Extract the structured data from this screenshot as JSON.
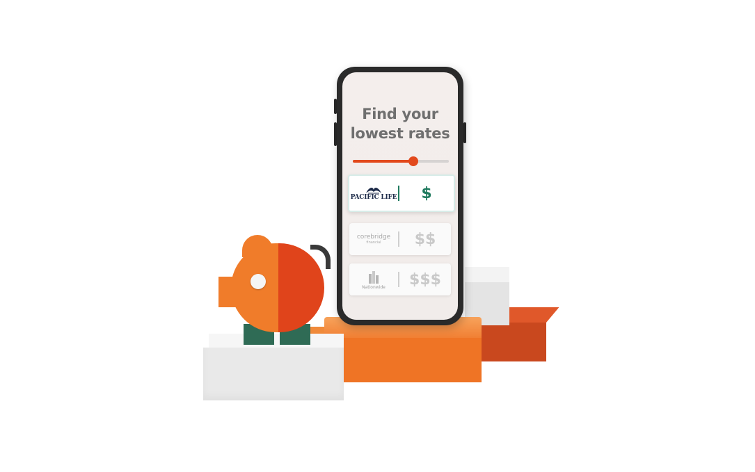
{
  "phone": {
    "headline_line1": "Find your",
    "headline_line2": "lowest rates",
    "slider_value_percent": 63,
    "cards": [
      {
        "logo_text": "PACIFIC LIFE",
        "logo_icon": "whale-tail-logo-icon",
        "price": "$",
        "highlighted": true
      },
      {
        "logo_text": "corebridge",
        "logo_subtext": "financial",
        "price": "$$",
        "highlighted": false
      },
      {
        "logo_text": "Nationwide",
        "logo_icon": "building-logo-icon",
        "price": "$$$",
        "highlighted": false
      }
    ]
  },
  "colors": {
    "accent_orange": "#e2491c",
    "brand_green": "#1f7a5e",
    "piggy_light": "#f07c2a",
    "piggy_dark": "#e0441b"
  }
}
